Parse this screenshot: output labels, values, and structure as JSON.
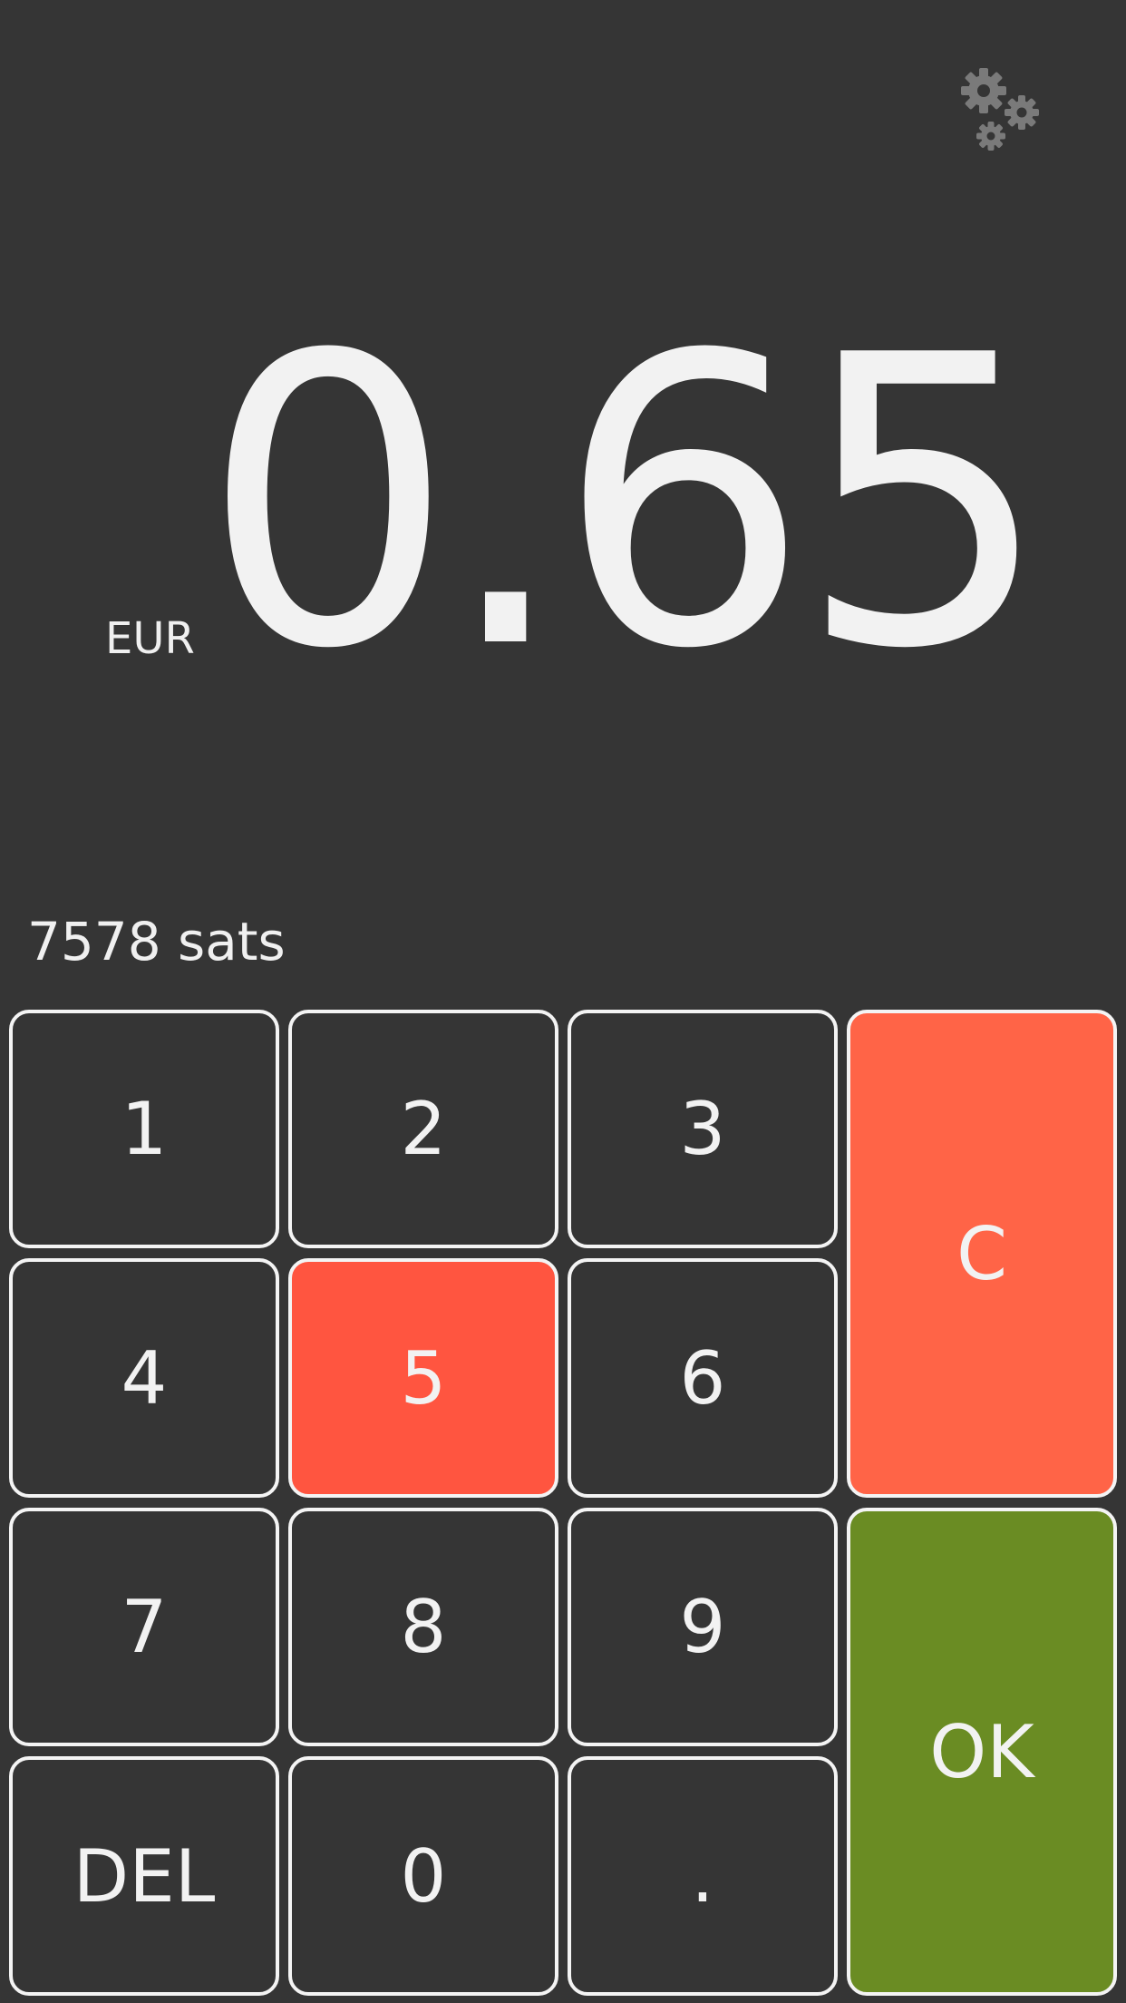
{
  "header": {
    "settings_icon": "gears-icon"
  },
  "display": {
    "currency": "EUR",
    "amount": "0.65",
    "sats": "7578 sats"
  },
  "keypad": {
    "k1": "1",
    "k2": "2",
    "k3": "3",
    "k4": "4",
    "k5": "5",
    "k6": "6",
    "k7": "7",
    "k8": "8",
    "k9": "9",
    "k0": "0",
    "kdel": "DEL",
    "kdot": ".",
    "kclear": "C",
    "kok": "OK"
  },
  "colors": {
    "background": "#353535",
    "highlight": "#ff5540",
    "clear": "#ff6447",
    "ok": "#6a8c23",
    "key_border": "#f4f4f4"
  }
}
